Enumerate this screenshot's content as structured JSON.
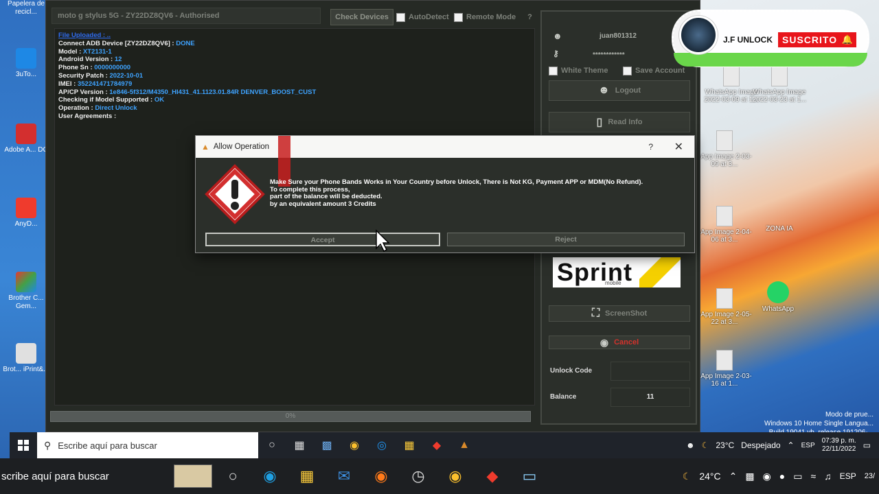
{
  "desktop": {
    "left_icons": [
      {
        "label": "Papelera de recicl..."
      },
      {
        "label": "3uTo..."
      },
      {
        "label": "Adobe A... DC"
      },
      {
        "label": "AnyD..."
      },
      {
        "label": "Brother C... Gem..."
      },
      {
        "label": "Brot... iPrint&..."
      }
    ],
    "right_icons": [
      {
        "label": "WhatsApp Image 2022-03-09 at 1..."
      },
      {
        "label": "WhatsApp Image 2022-03-23 at 1..."
      },
      {
        "label": "sApp Image 2-03-09 at 3..."
      },
      {
        "label": "ZONA IA"
      },
      {
        "label": "sApp Image 2-04-06 at 3..."
      },
      {
        "label": "WhatsApp"
      },
      {
        "label": "sApp Image 2-05-22 at 3..."
      },
      {
        "label": "sApp Image 2-03-16 at 1..."
      }
    ],
    "windows_info": [
      "Modo de prue...",
      "Windows 10 Home Single Langua...",
      "Build 19041.vb_release.191206-..."
    ]
  },
  "app": {
    "device_title": "moto g stylus 5G - ZY22DZ8QV6 - Authorised",
    "check_devices_label": "Check Devices",
    "autodetect_label": "AutoDetect",
    "remote_mode_label": "Remote Mode",
    "remote_mode_hint": "?",
    "log_link": "File Uploaded : ..",
    "log": [
      {
        "k": "Connect ADB Device [ZY22DZ8QV6] : ",
        "v": "DONE"
      },
      {
        "k": "Model : ",
        "v": "XT2131-1"
      },
      {
        "k": "Android Version : ",
        "v": "12"
      },
      {
        "k": "Phone Sn : ",
        "v": "0000000000"
      },
      {
        "k": "Security Patch : ",
        "v": "2022-10-01"
      },
      {
        "k": "IMEI : ",
        "v": "352241471784979"
      },
      {
        "k": "AP/CP Version : ",
        "v": "1e846-5f312/M4350_HI431_41.1123.01.84R DENVER_BOOST_CUST"
      },
      {
        "k": "Checking if Model Supported : ",
        "v": "OK"
      },
      {
        "k": "Operation : ",
        "v": "Direct Unlock"
      },
      {
        "k": "User Agreements : ",
        "v": ""
      }
    ],
    "progress_text": "0%",
    "progress_fraction": 0
  },
  "panel": {
    "username": "juan801312",
    "password_mask": "************",
    "white_theme_label": "White Theme",
    "save_account_label": "Save Account",
    "logout_label": "Logout",
    "read_info_label": "Read Info",
    "carrier_logo": "Sprint",
    "carrier_logo_sub": "mobile",
    "screenshot_label": "ScreenShot",
    "cancel_label": "Cancel",
    "unlock_code_label": "Unlock Code",
    "unlock_code_value": "",
    "balance_label": "Balance",
    "balance_value": "11"
  },
  "dialog": {
    "title": "Allow Operation",
    "help": "?",
    "close": "✕",
    "lines": [
      "Make Sure your Phone Bands Works in Your Country before Unlock, There is Not KG, Payment APP or MDM(No Refund).",
      "To complete this process,",
      "part of the balance will be deducted.",
      "by an equivalent amount 3 Credits"
    ],
    "accept_label": "Accept",
    "reject_label": "Reject"
  },
  "subscribe": {
    "channel": "J.F UNLOCK",
    "button": "SUSCRITO",
    "bell": "🔔"
  },
  "taskbar_inner": {
    "search_placeholder": "Escribe aquí para buscar",
    "temperature": "23°C",
    "weather": "Despejado",
    "language": "ESP",
    "time": "07:39 p. m.",
    "date": "22/11/2022"
  },
  "taskbar_outer": {
    "search_text": "scribe aquí para buscar",
    "temperature": "24°C",
    "language": "ESP",
    "date_fragment": "23/"
  },
  "colors": {
    "log_value": "#3ea3ff",
    "subscribe_red": "#e8151b",
    "subscribe_green": "#6ad64a"
  }
}
